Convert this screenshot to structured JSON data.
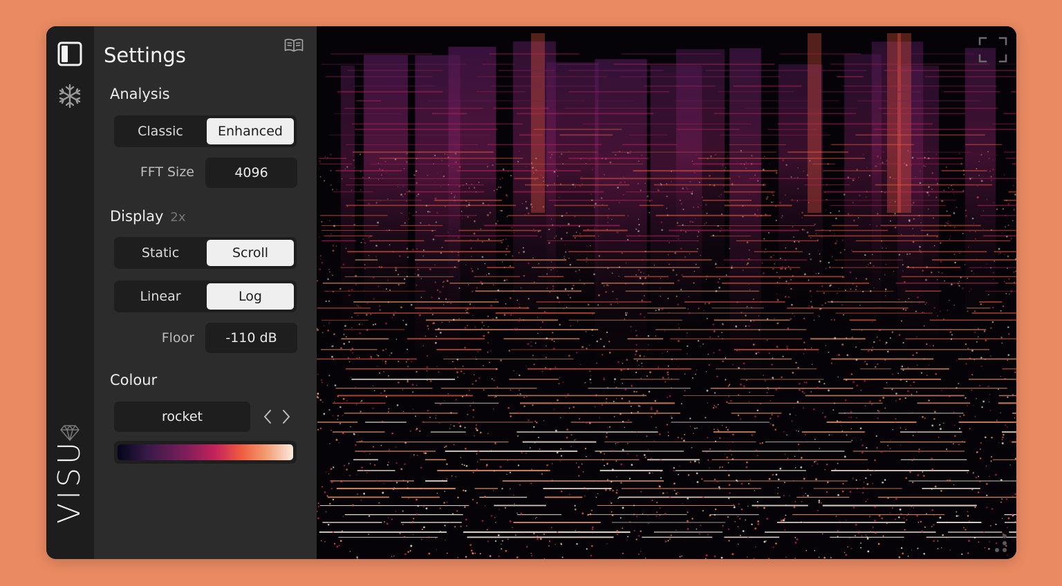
{
  "app": {
    "brand": "VISU"
  },
  "panel": {
    "title": "Settings"
  },
  "analysis": {
    "title": "Analysis",
    "modes": [
      "Classic",
      "Enhanced"
    ],
    "selected": "Enhanced",
    "fft_label": "FFT Size",
    "fft_value": "4096"
  },
  "display": {
    "title": "Display",
    "badge": "2x",
    "motion": [
      "Static",
      "Scroll"
    ],
    "motion_selected": "Scroll",
    "scale": [
      "Linear",
      "Log"
    ],
    "scale_selected": "Log",
    "floor_label": "Floor",
    "floor_value": "-110 dB"
  },
  "colour": {
    "title": "Colour",
    "colormap": "rocket",
    "gradient": [
      "#03051a",
      "#3b1a4a",
      "#7a1e5a",
      "#c5245a",
      "#ef5a3f",
      "#f39a6e",
      "#faebdd"
    ]
  },
  "icons": {
    "sidebar_toggle": "sidebar-toggle-icon",
    "freeze": "snowflake-icon",
    "premium": "diamond-icon",
    "docs": "book-icon",
    "prev": "chevron-left-icon",
    "next": "chevron-right-icon",
    "fullscreen": "fullscreen-icon",
    "resize": "resize-grip-icon"
  }
}
